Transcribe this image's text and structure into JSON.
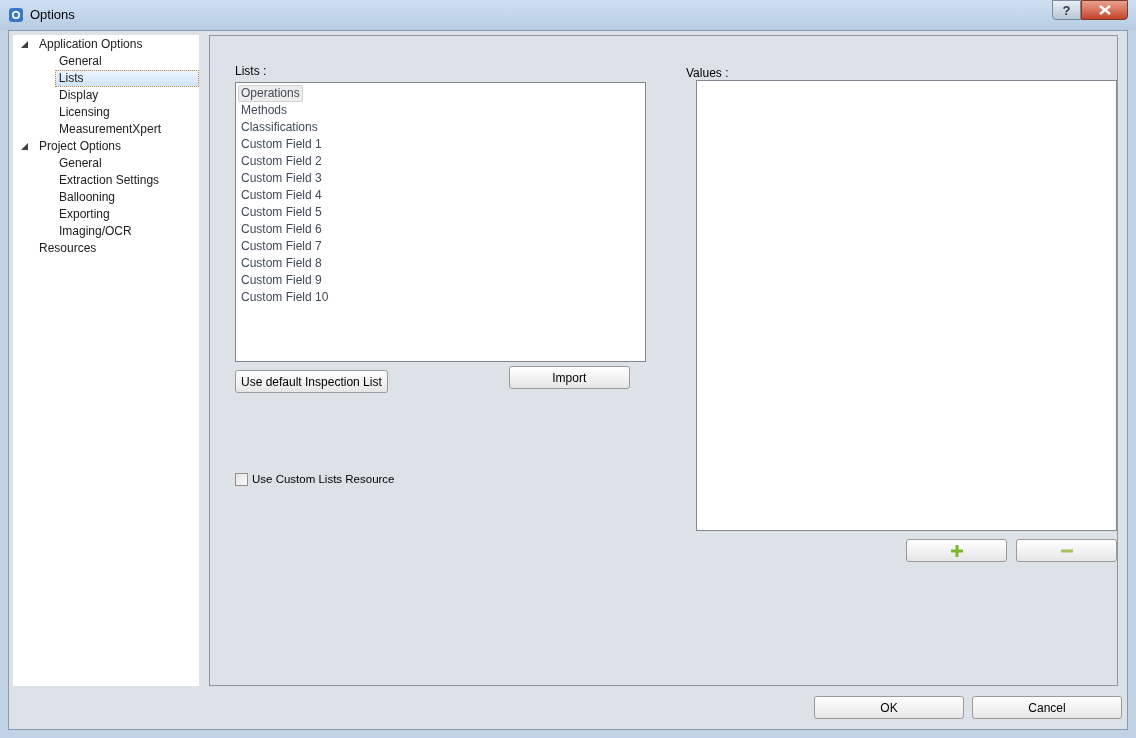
{
  "window": {
    "title": "Options",
    "help": "?"
  },
  "tree": [
    {
      "label": "Application Options",
      "expanded": true,
      "selected": false,
      "children": [
        {
          "label": "General",
          "selected": false
        },
        {
          "label": "Lists",
          "selected": true
        },
        {
          "label": "Display",
          "selected": false
        },
        {
          "label": "Licensing",
          "selected": false
        },
        {
          "label": "MeasurementXpert",
          "selected": false
        }
      ]
    },
    {
      "label": "Project Options",
      "expanded": true,
      "selected": false,
      "children": [
        {
          "label": "General",
          "selected": false
        },
        {
          "label": "Extraction Settings",
          "selected": false
        },
        {
          "label": "Ballooning",
          "selected": false
        },
        {
          "label": "Exporting",
          "selected": false
        },
        {
          "label": "Imaging/OCR",
          "selected": false
        }
      ]
    },
    {
      "label": "Resources",
      "selected": false
    }
  ],
  "lists": {
    "label": "Lists :",
    "items": [
      {
        "label": "Operations",
        "selected": true
      },
      {
        "label": "Methods",
        "selected": false
      },
      {
        "label": "Classifications",
        "selected": false
      },
      {
        "label": "Custom Field 1",
        "selected": false
      },
      {
        "label": "Custom Field 2",
        "selected": false
      },
      {
        "label": "Custom Field 3",
        "selected": false
      },
      {
        "label": "Custom Field 4",
        "selected": false
      },
      {
        "label": "Custom Field 5",
        "selected": false
      },
      {
        "label": "Custom Field 6",
        "selected": false
      },
      {
        "label": "Custom Field 7",
        "selected": false
      },
      {
        "label": "Custom Field 8",
        "selected": false
      },
      {
        "label": "Custom Field 9",
        "selected": false
      },
      {
        "label": "Custom Field 10",
        "selected": false
      }
    ],
    "default_button": "Use default Inspection List",
    "import_button": "Import"
  },
  "custom_lists_resource": {
    "label": "Use Custom Lists Resource",
    "checked": false
  },
  "values": {
    "label": "Values :"
  },
  "buttons": [
    "OK",
    "Cancel"
  ]
}
